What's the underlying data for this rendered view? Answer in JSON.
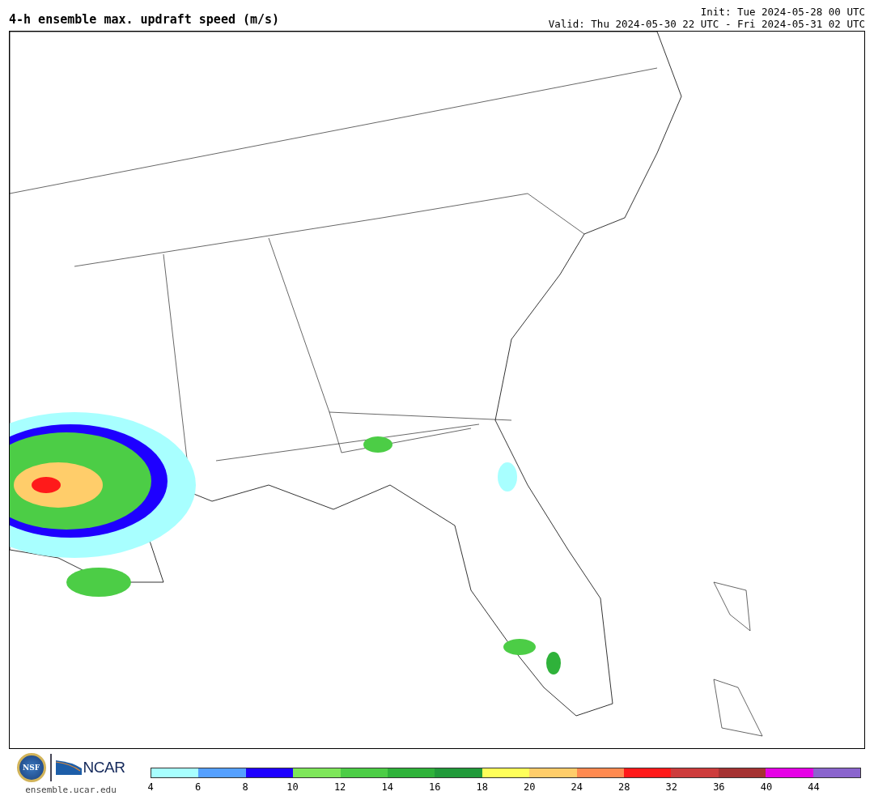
{
  "header": {
    "title": "4-h ensemble max. updraft speed (m/s)",
    "init": "Init: Tue 2024-05-28 00 UTC",
    "valid": "Valid: Thu 2024-05-30 22 UTC - Fri 2024-05-31 02 UTC"
  },
  "footer": {
    "seal_text": "NSF",
    "logo_text": "NCAR",
    "site": "ensemble.ucar.edu"
  },
  "colorbar": {
    "segments": [
      {
        "color": "#a8ffff"
      },
      {
        "color": "#55a0ff"
      },
      {
        "color": "#1e00ff"
      },
      {
        "color": "#7ee65a"
      },
      {
        "color": "#4ccd46"
      },
      {
        "color": "#2fb23a"
      },
      {
        "color": "#219a3a"
      },
      {
        "color": "#ffff5a"
      },
      {
        "color": "#ffcd6a"
      },
      {
        "color": "#ff8a50"
      },
      {
        "color": "#ff1a1a"
      },
      {
        "color": "#cd3c3c"
      },
      {
        "color": "#a53232"
      },
      {
        "color": "#e600e6"
      },
      {
        "color": "#8a64cd"
      }
    ],
    "ticks": [
      "4",
      "6",
      "8",
      "10",
      "12",
      "14",
      "16",
      "18",
      "20",
      "24",
      "28",
      "32",
      "36",
      "40",
      "44"
    ]
  }
}
